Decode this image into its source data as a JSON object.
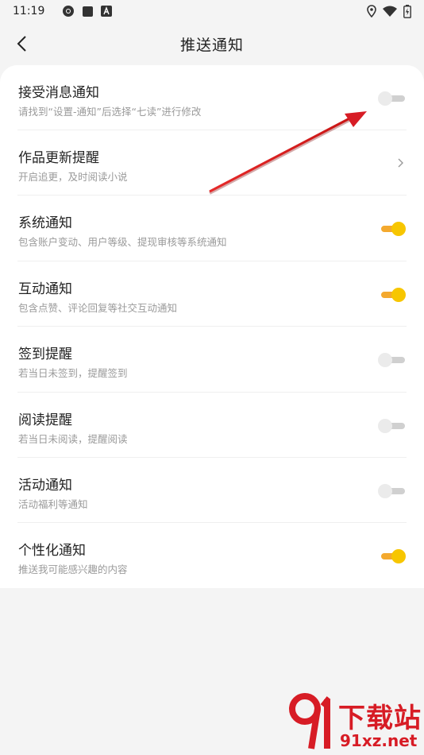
{
  "status_bar": {
    "time": "11:19",
    "left_icons": [
      "chrome-icon",
      "square-icon",
      "a-icon"
    ],
    "right_icons": [
      "location-icon",
      "wifi-icon",
      "battery-icon"
    ]
  },
  "header": {
    "title": "推送通知",
    "back_icon": "chevron-left-icon"
  },
  "settings": [
    {
      "label": "接受消息通知",
      "desc": "请找到“设置-通知”后选择“七读”进行修改",
      "control": "toggle",
      "on": false
    },
    {
      "label": "作品更新提醒",
      "desc": "开启追更，及时阅读小说",
      "control": "chevron"
    },
    {
      "label": "系统通知",
      "desc": "包含账户变动、用户等级、提现审核等系统通知",
      "control": "toggle",
      "on": true
    },
    {
      "label": "互动通知",
      "desc": "包含点赞、评论回复等社交互动通知",
      "control": "toggle",
      "on": true
    },
    {
      "label": "签到提醒",
      "desc": "若当日未签到，提醒签到",
      "control": "toggle",
      "on": false
    },
    {
      "label": "阅读提醒",
      "desc": "若当日未阅读，提醒阅读",
      "control": "toggle",
      "on": false
    },
    {
      "label": "活动通知",
      "desc": "活动福利等通知",
      "control": "toggle",
      "on": false
    },
    {
      "label": "个性化通知",
      "desc": "推送我可能感兴趣的内容",
      "control": "toggle",
      "on": true
    }
  ],
  "colors": {
    "toggle_on_thumb": "#f7c600",
    "toggle_on_track": "#f4a92e",
    "toggle_off_thumb": "#ebebeb",
    "toggle_off_track": "#d0d0d0",
    "annotation_arrow": "#d71c25"
  },
  "watermark": {
    "top": "下载站",
    "bottom": "91xz.net"
  }
}
